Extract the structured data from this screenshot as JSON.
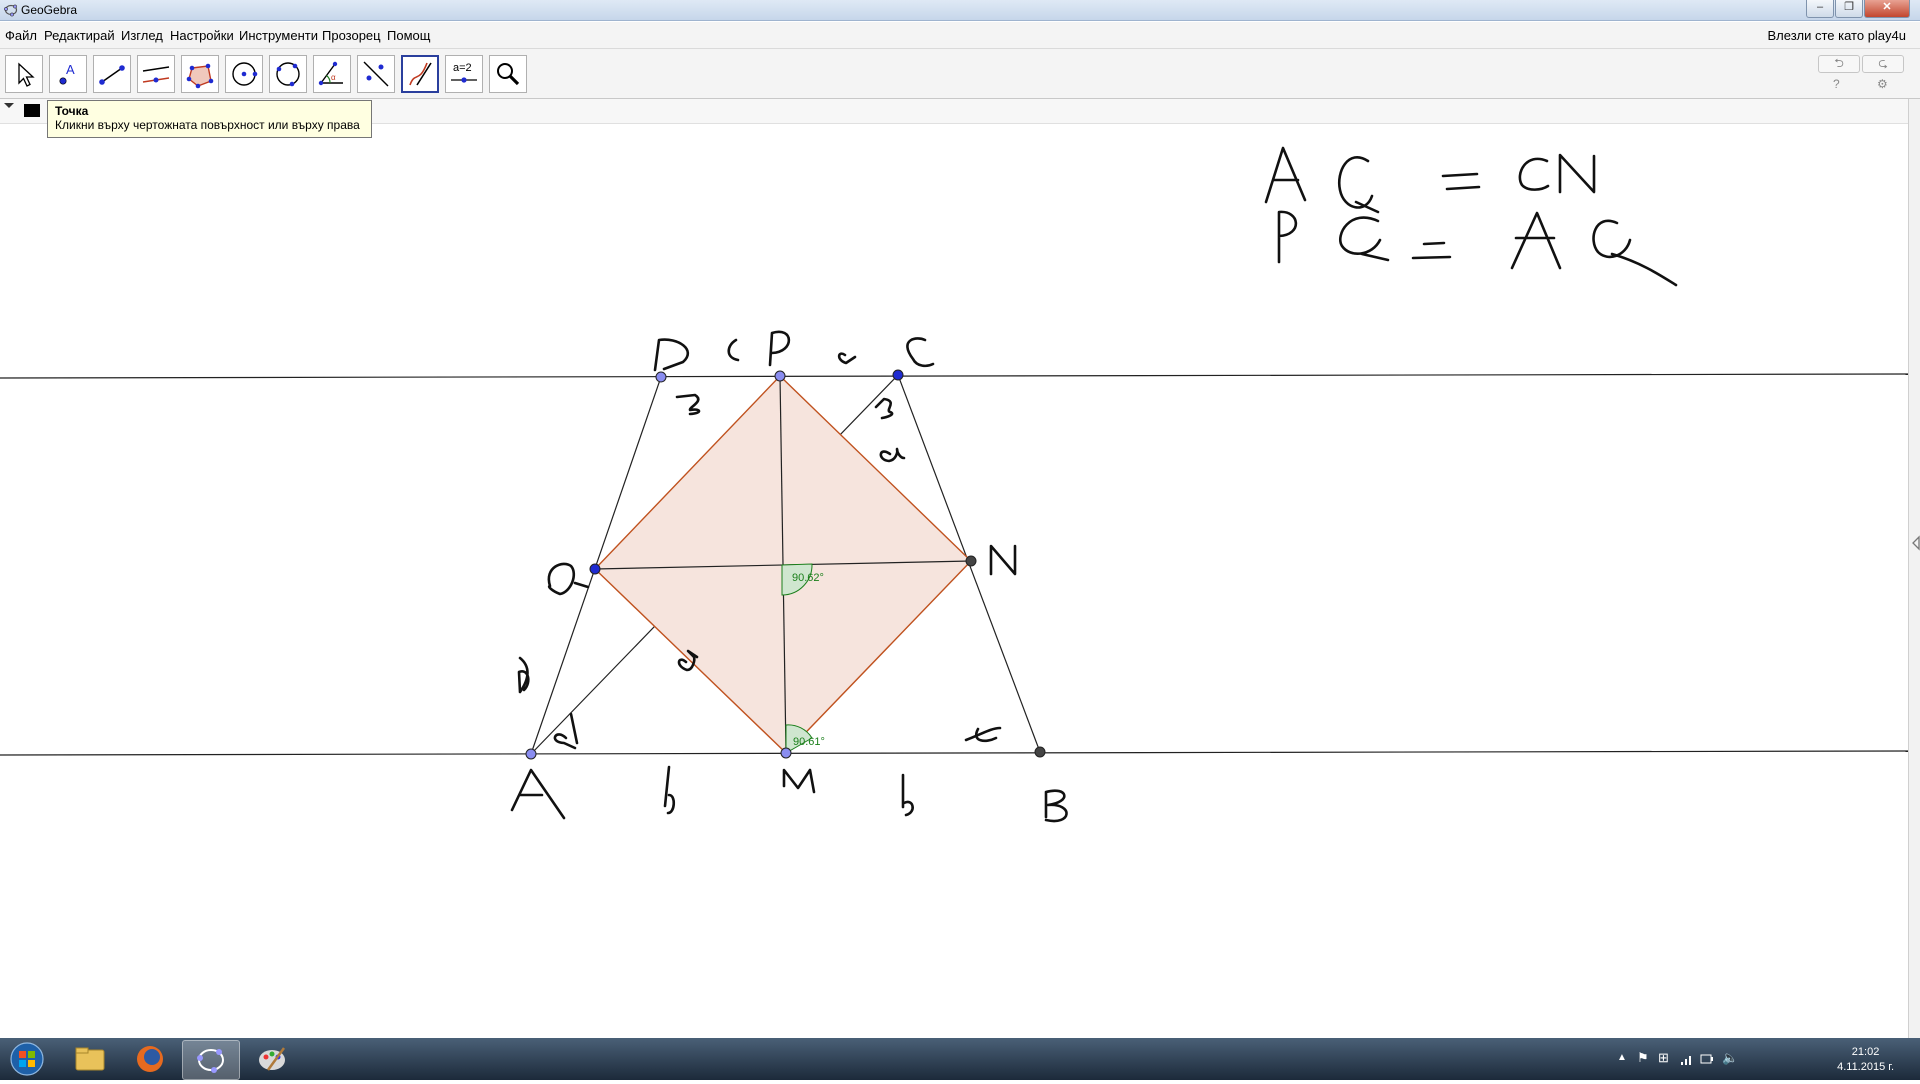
{
  "window": {
    "title": "GeoGebra"
  },
  "menu": {
    "items": [
      "Файл",
      "Редактирай",
      "Изглед",
      "Настройки",
      "Инструменти",
      "Прозорец",
      "Помощ"
    ],
    "login": "Влезли сте като play4u"
  },
  "toolbar": {
    "tools": [
      "move",
      "point",
      "line",
      "perpendicular",
      "polygon",
      "circle",
      "conic",
      "angle",
      "reflect",
      "freehand",
      "slider",
      "zoom"
    ],
    "active_tool": "freehand",
    "slider_text": "a=2",
    "help": "?",
    "settings": "⚙"
  },
  "tooltip": {
    "title": "Точка",
    "text": "Кликни върху чертожната повърхност или върху права"
  },
  "graphics": {
    "angles": [
      "90.62°",
      "90.61°"
    ]
  },
  "taskbar": {
    "time": "21:02",
    "date": "4.11.2015 г."
  },
  "colors": {
    "polygon_fill": "#f6e4dd",
    "polygon_stroke": "#c0521f",
    "point_blue": "#1f2bd1",
    "angle_green": "#1b7f1b"
  }
}
